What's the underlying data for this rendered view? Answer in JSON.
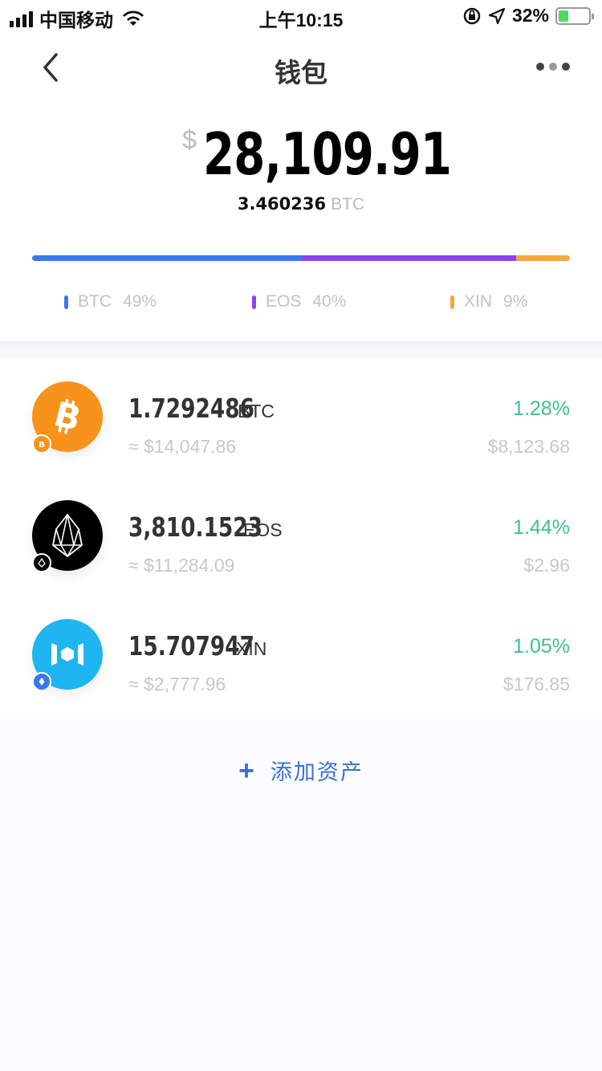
{
  "status_bar": {
    "carrier": "中国移动",
    "time": "上午10:15",
    "battery": "32%",
    "battery_level": 0.32
  },
  "header": {
    "title": "钱包",
    "back_icon": "chevron-left-icon",
    "more_icon": "more-dots-icon"
  },
  "summary": {
    "currency_symbol": "$",
    "total": "28,109.91",
    "btc_amount": "3.460236",
    "btc_unit": "BTC",
    "distribution": [
      {
        "symbol": "BTC",
        "percent": "49%",
        "fraction": 0.5,
        "color": "#3a78f0"
      },
      {
        "symbol": "EOS",
        "percent": "40%",
        "fraction": 0.4,
        "color": "#8a43f0"
      },
      {
        "symbol": "XIN",
        "percent": "9%",
        "fraction": 0.1,
        "color": "#f5a742"
      }
    ]
  },
  "assets": [
    {
      "amount": "1.7292486",
      "symbol": "BTC",
      "fiat": "≈ $14,047.86",
      "change": "1.28%",
      "price": "$8,123.68",
      "icon": "bitcoin-icon",
      "color": "#f7931a"
    },
    {
      "amount": "3,810.1523",
      "symbol": "EOS",
      "fiat": "≈ $11,284.09",
      "change": "1.44%",
      "price": "$2.96",
      "icon": "eos-icon",
      "color": "#000000"
    },
    {
      "amount": "15.707947",
      "symbol": "XIN",
      "fiat": "≈ $2,777.96",
      "change": "1.05%",
      "price": "$176.85",
      "icon": "mixin-icon",
      "color": "#1eb5f0"
    }
  ],
  "add_asset": {
    "label": "添加资产",
    "icon": "plus-icon"
  }
}
